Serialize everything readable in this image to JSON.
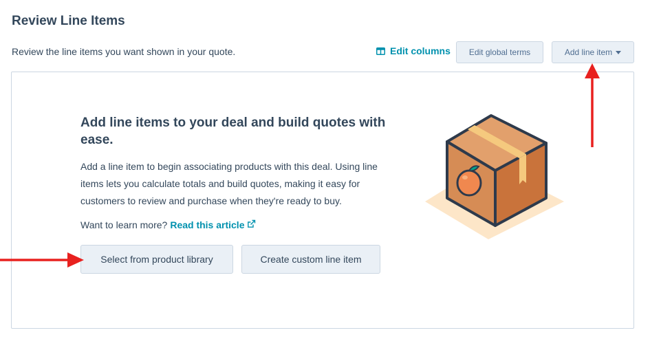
{
  "section": {
    "title": "Review Line Items",
    "subtitle": "Review the line items you want shown in your quote."
  },
  "toolbar": {
    "edit_columns_label": "Edit columns",
    "edit_columns_icon": "columns-icon",
    "edit_global_terms_label": "Edit global terms",
    "add_line_item_label": "Add line item",
    "add_line_item_icon": "caret-down-icon"
  },
  "empty_state": {
    "heading": "Add line items to your deal and build quotes with ease.",
    "body": "Add a line item to begin associating products with this deal. Using line items lets you calculate totals and build quotes, making it easy for customers to review and purchase when they're ready to buy.",
    "learn_more_prefix": "Want to learn more?",
    "learn_more_link": "Read this article",
    "learn_more_icon": "external-link-icon",
    "illustration": "box-with-orange-icon",
    "primary_button_label": "Select from product library",
    "secondary_button_label": "Create custom line item"
  },
  "annotations": {
    "arrow_color": "#e8211f",
    "arrows": [
      "arrow-up-to-add-line-item",
      "arrow-right-to-select-from-product-library"
    ]
  },
  "colors": {
    "text": "#33475b",
    "link": "#0091ae",
    "button_bg": "#eaf0f6",
    "button_border": "#cbd6e2",
    "panel_border": "#cbd6e2"
  }
}
